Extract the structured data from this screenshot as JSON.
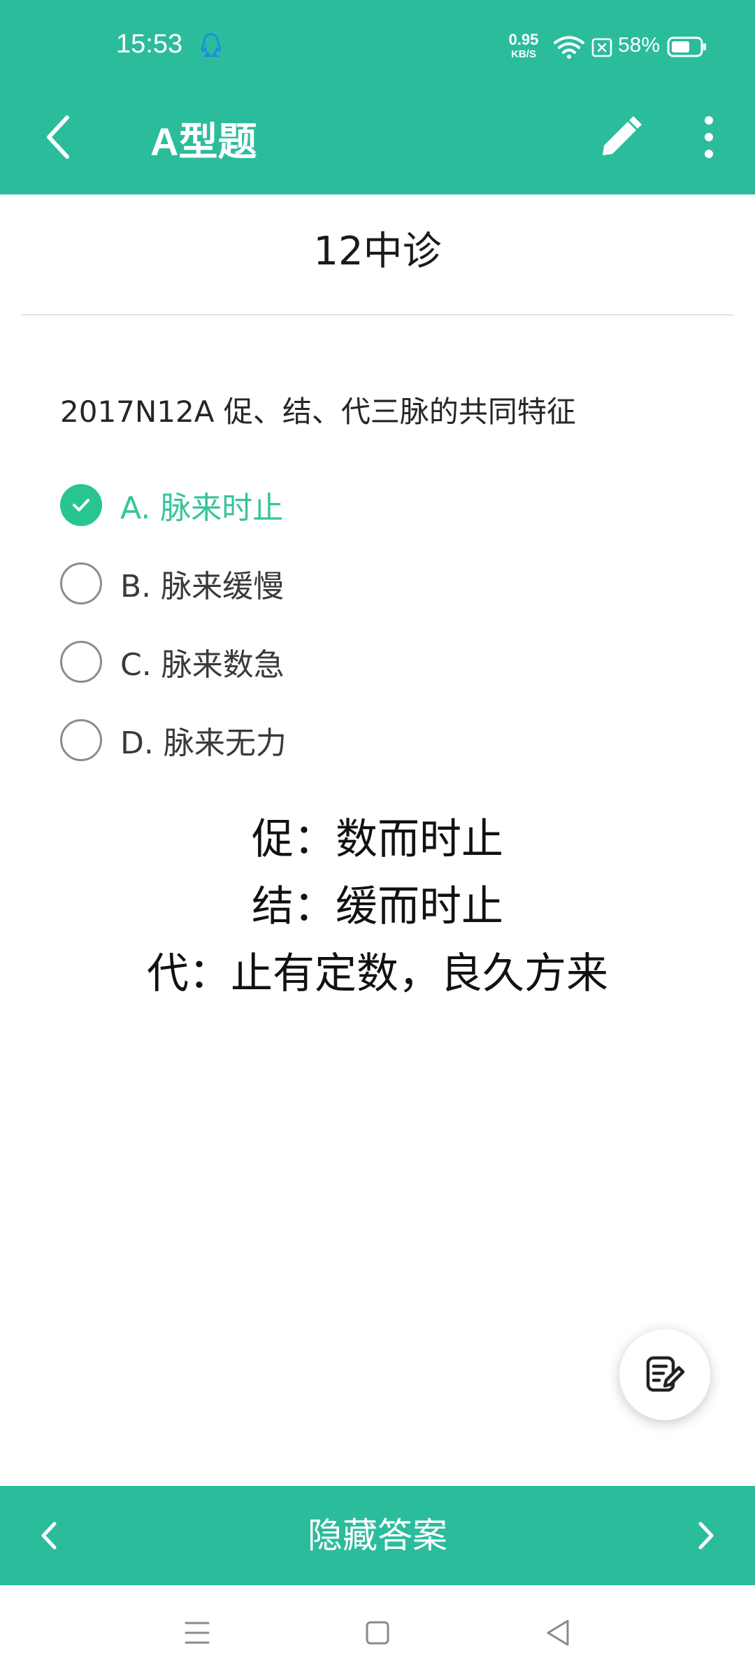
{
  "status_bar": {
    "time": "15:53",
    "net_speed_value": "0.95",
    "net_speed_unit": "KB/S",
    "battery_percent": "58%",
    "icons": [
      "qq-icon",
      "wifi-icon",
      "sim-off-icon",
      "battery-icon"
    ]
  },
  "app_bar": {
    "title": "A型题",
    "icons": [
      "back-arrow-icon",
      "edit-pencil-icon",
      "more-vertical-icon"
    ]
  },
  "section": {
    "title": "12中诊"
  },
  "question": {
    "text": "2017N12A  促、结、代三脉的共同特征",
    "options": [
      {
        "label": "A. 脉来时止",
        "selected": true,
        "correct": true
      },
      {
        "label": "B. 脉来缓慢",
        "selected": false,
        "correct": false
      },
      {
        "label": "C. 脉来数急",
        "selected": false,
        "correct": false
      },
      {
        "label": "D. 脉来无力",
        "selected": false,
        "correct": false
      }
    ]
  },
  "analysis": {
    "lines": [
      "促：数而时止",
      "结：缓而时止",
      "代：止有定数，良久方来"
    ]
  },
  "fab": {
    "icon": "note-edit-icon"
  },
  "bottom_bar": {
    "toggle_label": "隐藏答案",
    "icons": [
      "chevron-left-icon",
      "chevron-right-icon"
    ]
  },
  "system_nav": {
    "icons": [
      "menu-icon",
      "home-icon",
      "back-triangle-icon"
    ]
  },
  "colors": {
    "primary": "#2BBC9C",
    "correct": "#35C59A",
    "text": "#1f1f1f"
  }
}
